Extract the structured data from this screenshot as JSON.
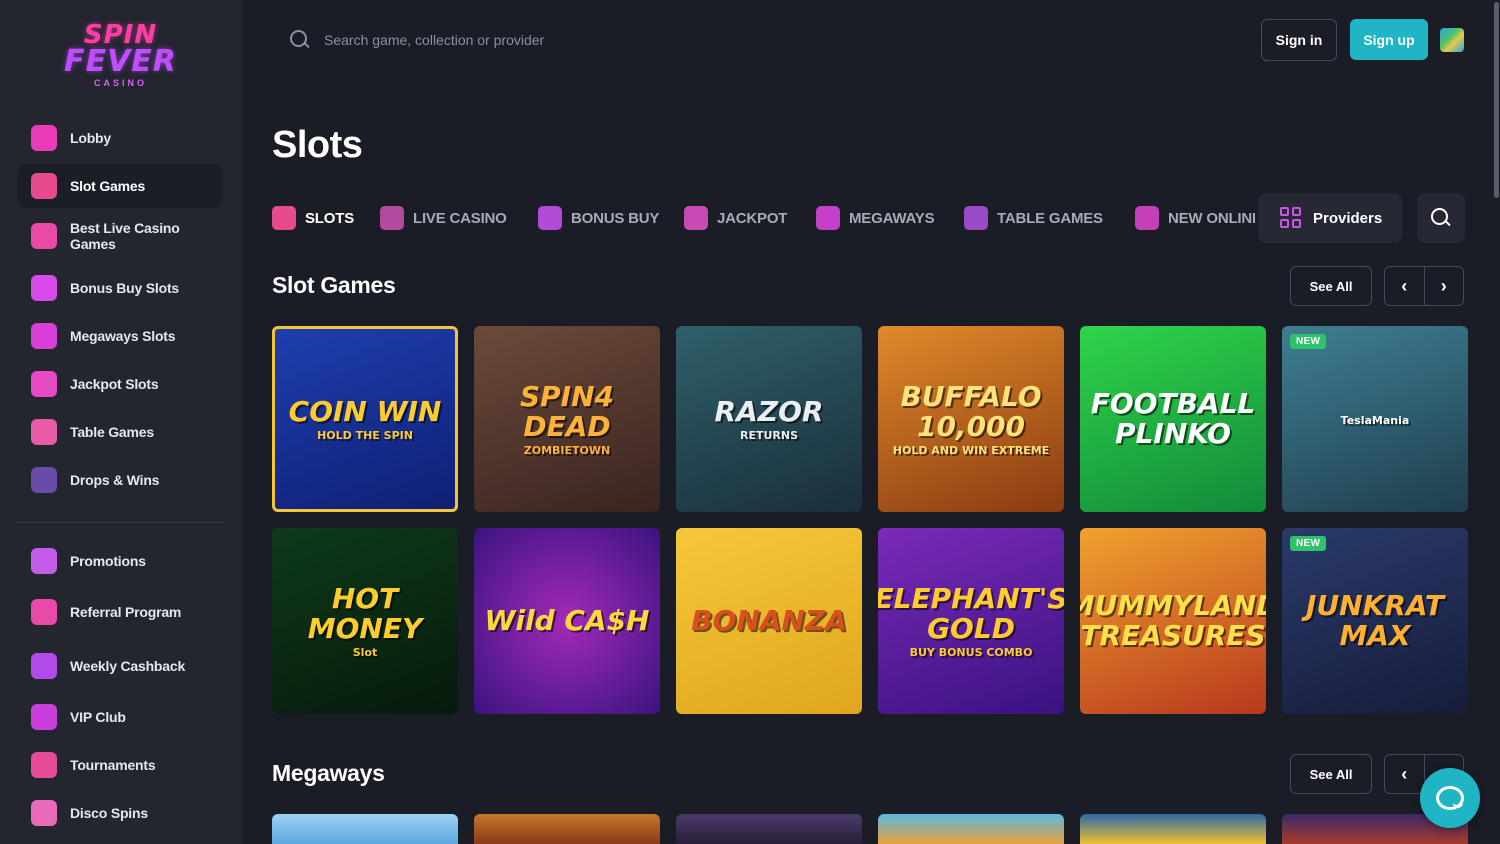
{
  "brand": {
    "line1": "SPIN",
    "line2": "FEVER",
    "line3": "CASINO"
  },
  "sidebar": {
    "items": [
      {
        "label": "Lobby",
        "icon": "house-icon",
        "color": "#e93ab8"
      },
      {
        "label": "Slot Games",
        "icon": "cherries-icon",
        "color": "#e74a8e",
        "active": true
      },
      {
        "label": "Best Live Casino Games",
        "icon": "cards-box-icon",
        "color": "#e94aa6"
      },
      {
        "label": "Bonus Buy Slots",
        "icon": "money-bag-icon",
        "color": "#d84ae8"
      },
      {
        "label": "Megaways Slots",
        "icon": "megaways-m-icon",
        "color": "#d83fd8"
      },
      {
        "label": "Jackpot Slots",
        "icon": "diamond-icon",
        "color": "#e84ac4"
      },
      {
        "label": "Table Games",
        "icon": "playing-cards-icon",
        "color": "#ea5ba6"
      },
      {
        "label": "Drops & Wins",
        "icon": "drops-wins-icon",
        "color": "#6a4ca8"
      }
    ],
    "secondary": [
      {
        "label": "Promotions",
        "icon": "gift-icon",
        "color": "#c45ce8"
      },
      {
        "label": "Referral Program",
        "icon": "users-icon",
        "color": "#e84aa8"
      },
      {
        "label": "Weekly Cashback",
        "icon": "dollar-coin-icon",
        "color": "#b14ae8"
      },
      {
        "label": "VIP Club",
        "icon": "crown-icon",
        "color": "#c93fdc"
      },
      {
        "label": "Tournaments",
        "icon": "trophy-icon",
        "color": "#e84a9a"
      },
      {
        "label": "Disco Spins",
        "icon": "disco-ball-icon",
        "color": "#e86ab8"
      }
    ]
  },
  "header": {
    "search_placeholder": "Search game, collection or provider",
    "signin_label": "Sign in",
    "signup_label": "Sign up"
  },
  "page": {
    "title": "Slots"
  },
  "categories": [
    {
      "label": "SLOTS",
      "icon": "cherries-icon",
      "active": true,
      "color": "#e74a8e"
    },
    {
      "label": "LIVE CASINO",
      "icon": "cards-box-icon",
      "color": "#b44aa0"
    },
    {
      "label": "BONUS BUY",
      "icon": "money-bag-icon",
      "color": "#b44ad8"
    },
    {
      "label": "JACKPOT",
      "icon": "diamond-icon",
      "color": "#c84ab4"
    },
    {
      "label": "MEGAWAYS",
      "icon": "megaways-m-icon",
      "color": "#c43fc8"
    },
    {
      "label": "TABLE GAMES",
      "icon": "playing-cards-icon",
      "color": "#9a4ac8"
    },
    {
      "label": "NEW ONLINE",
      "icon": "lightning-icon",
      "color": "#c43fb8"
    }
  ],
  "providers_label": "Providers",
  "sections": [
    {
      "title": "Slot Games",
      "see_all": "See All"
    },
    {
      "title": "Megaways",
      "see_all": "See All"
    }
  ],
  "games": [
    {
      "title": "COIN WIN",
      "sub": "HOLD THE SPIN",
      "bg": "linear-gradient(160deg,#1e3fb0,#0f1f73)",
      "color": "#ffcc2e",
      "selected": true
    },
    {
      "title": "SPIN4 DEAD",
      "sub": "ZOMBIETOWN",
      "bg": "linear-gradient(160deg,#6b4a3a,#3a2420)",
      "color": "#ffb23a"
    },
    {
      "title": "RAZOR",
      "sub": "RETURNS",
      "bg": "linear-gradient(160deg,#2f5f6a,#1a2f3a)",
      "color": "#e8eef2"
    },
    {
      "title": "BUFFALO 10,000",
      "sub": "HOLD AND WIN EXTREME",
      "bg": "linear-gradient(160deg,#e08a2a,#8a3a12)",
      "color": "#ffe27a"
    },
    {
      "title": "FOOTBALL PLINKO",
      "sub": "",
      "bg": "linear-gradient(160deg,#2fd44a,#128a3a)",
      "color": "#ffffff"
    },
    {
      "title": "",
      "sub": "TeslaMania",
      "bg": "linear-gradient(160deg,#3e7f92,#1f3e4e)",
      "color": "#ffffff",
      "new": true
    },
    {
      "title": "HOT MONEY",
      "sub": "Slot",
      "bg": "linear-gradient(160deg,#0e3a1a,#061a0c)",
      "color": "#ffcc2e"
    },
    {
      "title": "Wild CA$H",
      "sub": "",
      "bg": "radial-gradient(circle,#a32ab8,#3a1380)",
      "color": "#ffd83a"
    },
    {
      "title": "BONANZA",
      "sub": "",
      "bg": "linear-gradient(160deg,#f5c83a,#e0a61e)",
      "color": "#d8501e"
    },
    {
      "title": "ELEPHANT'S GOLD",
      "sub": "BUY BONUS COMBO",
      "bg": "linear-gradient(160deg,#7a2ab8,#3a1280)",
      "color": "#ffcc2e"
    },
    {
      "title": "MUMMYLAND TREASURES",
      "sub": "",
      "bg": "linear-gradient(160deg,#f0a22e,#b8381e)",
      "color": "#ffe04a"
    },
    {
      "title": "JUNKRAT MAX",
      "sub": "",
      "bg": "linear-gradient(160deg,#2a3a6a,#151d3a)",
      "color": "#ffb02e",
      "new": true
    }
  ],
  "megaways_preview": [
    {
      "bg": "linear-gradient(180deg,#9ed2f5,#5aa8e0)"
    },
    {
      "bg": "linear-gradient(180deg,#c8762a,#8a3a1a)"
    },
    {
      "bg": "linear-gradient(180deg,#4a3a6a,#2a1f3a)"
    },
    {
      "bg": "linear-gradient(180deg,#5ab8e0,#e8a23a)"
    },
    {
      "bg": "linear-gradient(180deg,#2a6aa8,#f0c02e)"
    },
    {
      "bg": "linear-gradient(180deg,#3a2a6a,#a83a2a)"
    }
  ],
  "badge_new": "NEW"
}
